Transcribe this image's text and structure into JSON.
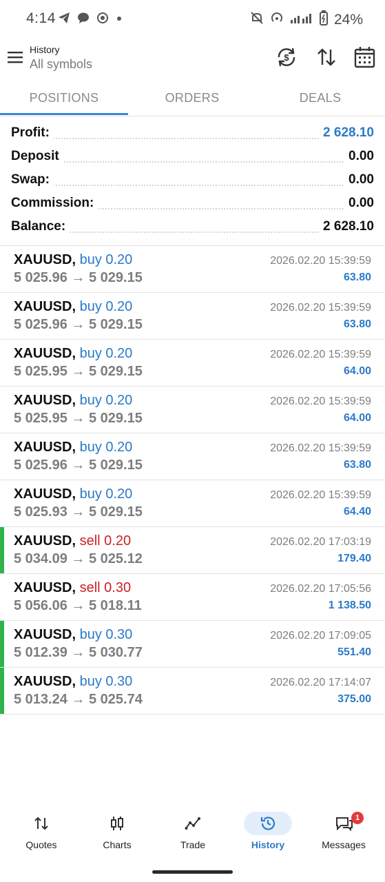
{
  "status_bar": {
    "time": "4:14",
    "battery": "24%",
    "icons": [
      "telegram-icon",
      "chat-icon",
      "record-icon",
      "dot-icon",
      "mute-icon",
      "hotspot-icon",
      "signal-icon",
      "battery-icon"
    ]
  },
  "header": {
    "title": "History",
    "subtitle": "All symbols",
    "actions": [
      "currency-icon",
      "sort-icon",
      "calendar-icon"
    ]
  },
  "tabs": [
    {
      "label": "POSITIONS",
      "active": true
    },
    {
      "label": "ORDERS",
      "active": false
    },
    {
      "label": "DEALS",
      "active": false
    }
  ],
  "summary": [
    {
      "label": "Profit:",
      "value": "2 628.10",
      "highlight": true
    },
    {
      "label": "Deposit",
      "value": "0.00",
      "highlight": false
    },
    {
      "label": "Swap:",
      "value": "0.00",
      "highlight": false
    },
    {
      "label": "Commission:",
      "value": "0.00",
      "highlight": false
    },
    {
      "label": "Balance:",
      "value": "2 628.10",
      "highlight": false
    }
  ],
  "deals": [
    {
      "symbol": "XAUUSD,",
      "side": "buy 0.20",
      "side_type": "buy",
      "prices": "5 025.96 → 5 029.15",
      "time": "2026.02.20 15:39:59",
      "profit": "63.80",
      "marked": false
    },
    {
      "symbol": "XAUUSD,",
      "side": "buy 0.20",
      "side_type": "buy",
      "prices": "5 025.96 → 5 029.15",
      "time": "2026.02.20 15:39:59",
      "profit": "63.80",
      "marked": false
    },
    {
      "symbol": "XAUUSD,",
      "side": "buy 0.20",
      "side_type": "buy",
      "prices": "5 025.95 → 5 029.15",
      "time": "2026.02.20 15:39:59",
      "profit": "64.00",
      "marked": false
    },
    {
      "symbol": "XAUUSD,",
      "side": "buy 0.20",
      "side_type": "buy",
      "prices": "5 025.95 → 5 029.15",
      "time": "2026.02.20 15:39:59",
      "profit": "64.00",
      "marked": false
    },
    {
      "symbol": "XAUUSD,",
      "side": "buy 0.20",
      "side_type": "buy",
      "prices": "5 025.96 → 5 029.15",
      "time": "2026.02.20 15:39:59",
      "profit": "63.80",
      "marked": false
    },
    {
      "symbol": "XAUUSD,",
      "side": "buy 0.20",
      "side_type": "buy",
      "prices": "5 025.93 → 5 029.15",
      "time": "2026.02.20 15:39:59",
      "profit": "64.40",
      "marked": false
    },
    {
      "symbol": "XAUUSD,",
      "side": "sell 0.20",
      "side_type": "sell",
      "prices": "5 034.09 → 5 025.12",
      "time": "2026.02.20 17:03:19",
      "profit": "179.40",
      "marked": true
    },
    {
      "symbol": "XAUUSD,",
      "side": "sell 0.30",
      "side_type": "sell",
      "prices": "5 056.06 → 5 018.11",
      "time": "2026.02.20 17:05:56",
      "profit": "1 138.50",
      "marked": false
    },
    {
      "symbol": "XAUUSD,",
      "side": "buy 0.30",
      "side_type": "buy",
      "prices": "5 012.39 → 5 030.77",
      "time": "2026.02.20 17:09:05",
      "profit": "551.40",
      "marked": true
    },
    {
      "symbol": "XAUUSD,",
      "side": "buy 0.30",
      "side_type": "buy",
      "prices": "5 013.24 → 5 025.74",
      "time": "2026.02.20 17:14:07",
      "profit": "375.00",
      "marked": true
    }
  ],
  "bottom_nav": [
    {
      "label": "Quotes",
      "icon": "quotes-icon",
      "active": false
    },
    {
      "label": "Charts",
      "icon": "charts-icon",
      "active": false
    },
    {
      "label": "Trade",
      "icon": "trade-icon",
      "active": false
    },
    {
      "label": "History",
      "icon": "history-icon",
      "active": true
    },
    {
      "label": "Messages",
      "icon": "messages-icon",
      "active": false,
      "badge": "1"
    }
  ],
  "colors": {
    "accent": "#2a7ac8",
    "buy": "#2a7ac8",
    "sell": "#cc2222",
    "marker": "#2fb34a",
    "badge": "#e23b3b"
  }
}
